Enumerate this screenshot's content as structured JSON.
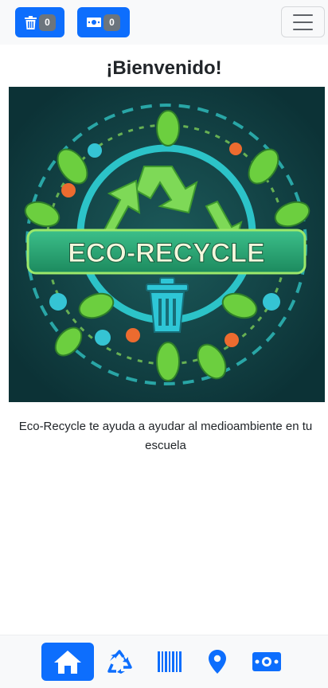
{
  "header": {
    "trash_count": "0",
    "money_count": "0",
    "icons": {
      "trash": "trash-icon",
      "money": "money-icon",
      "menu": "hamburger-icon"
    }
  },
  "main": {
    "title": "¡Bienvenido!",
    "logo_text": "ECO-RECYCLE",
    "description": "Eco-Recycle te ayuda a ayudar al medioambiente en tu escuela"
  },
  "bottom_nav": {
    "items": [
      {
        "icon": "home-icon",
        "active": true
      },
      {
        "icon": "recycle-icon",
        "active": false
      },
      {
        "icon": "barcode-icon",
        "active": false
      },
      {
        "icon": "map-pin-icon",
        "active": false
      },
      {
        "icon": "money-icon",
        "active": false
      }
    ]
  },
  "colors": {
    "primary": "#0d6efd",
    "badge": "#6c757d",
    "bar": "#f8f9fa",
    "logo_bg": "#0f3a3e",
    "logo_green": "#7ed957"
  }
}
